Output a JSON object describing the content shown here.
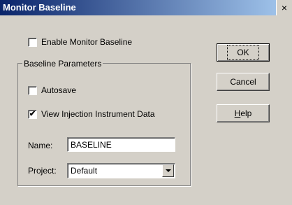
{
  "window": {
    "title": "Monitor Baseline",
    "close_icon": "×"
  },
  "enable_monitor": {
    "label": "Enable Monitor Baseline",
    "checked": false
  },
  "group": {
    "label": "Baseline Parameters",
    "autosave": {
      "label": "Autosave",
      "checked": false
    },
    "view_injection": {
      "label": "View Injection Instrument Data",
      "checked": true,
      "mark": "✔"
    },
    "name": {
      "label": "Name:",
      "value": "BASELINE"
    },
    "project": {
      "label": "Project:",
      "value": "Default"
    }
  },
  "buttons": {
    "ok": "OK",
    "cancel": "Cancel",
    "help_prefix": "H",
    "help_rest": "elp"
  }
}
